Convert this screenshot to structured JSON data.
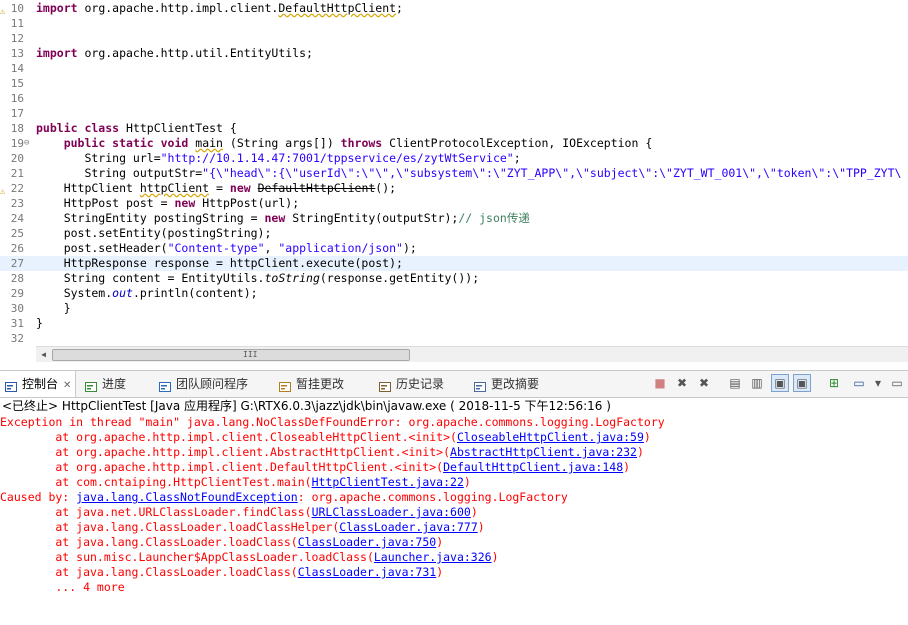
{
  "editor": {
    "lines": [
      {
        "num": "10",
        "segs": [
          {
            "t": "import ",
            "c": "kw"
          },
          {
            "t": "org.apache.http.impl.client.",
            "c": ""
          },
          {
            "t": "DefaultHttpClient",
            "c": "strike squig"
          },
          {
            "t": ";",
            "c": ""
          }
        ],
        "warn": true
      },
      {
        "num": "11",
        "segs": []
      },
      {
        "num": "12",
        "segs": []
      },
      {
        "num": "13",
        "segs": [
          {
            "t": "import ",
            "c": "kw"
          },
          {
            "t": "org.apache.http.util.EntityUtils;",
            "c": ""
          }
        ]
      },
      {
        "num": "14",
        "segs": []
      },
      {
        "num": "15",
        "segs": []
      },
      {
        "num": "16",
        "segs": []
      },
      {
        "num": "17",
        "segs": []
      },
      {
        "num": "18",
        "segs": [
          {
            "t": "public class ",
            "c": "kw"
          },
          {
            "t": "HttpClientTest {",
            "c": ""
          }
        ]
      },
      {
        "num": "19",
        "segs": [
          {
            "t": "    ",
            "c": ""
          },
          {
            "t": "public static void ",
            "c": "kw"
          },
          {
            "t": "main",
            "c": "squig"
          },
          {
            "t": " (String args[]) ",
            "c": ""
          },
          {
            "t": "throws ",
            "c": "kw"
          },
          {
            "t": "ClientProtocolException, IOException {",
            "c": ""
          }
        ],
        "fold": true
      },
      {
        "num": "20",
        "segs": [
          {
            "t": "       String url=",
            "c": ""
          },
          {
            "t": "\"http://10.1.14.47:7001/tppservice/es/zytWtService\"",
            "c": "str"
          },
          {
            "t": ";",
            "c": ""
          }
        ]
      },
      {
        "num": "21",
        "segs": [
          {
            "t": "       String outputStr=",
            "c": ""
          },
          {
            "t": "\"{\\\"head\\\":{\\\"userId\\\":\\\"\\\",\\\"subsystem\\\":\\\"ZYT_APP\\\",\\\"subject\\\":\\\"ZYT_WT_001\\\",\\\"token\\\":\\\"TPP_ZYT\\",
            "c": "str"
          }
        ]
      },
      {
        "num": "22",
        "segs": [
          {
            "t": "    HttpClient ",
            "c": ""
          },
          {
            "t": "httpClient",
            "c": "squig"
          },
          {
            "t": " = ",
            "c": ""
          },
          {
            "t": "new ",
            "c": "kw"
          },
          {
            "t": "DefaultHttpClient",
            "c": "strike"
          },
          {
            "t": "();",
            "c": ""
          }
        ],
        "warn": true
      },
      {
        "num": "23",
        "segs": [
          {
            "t": "    HttpPost post = ",
            "c": ""
          },
          {
            "t": "new ",
            "c": "kw"
          },
          {
            "t": "HttpPost(url);",
            "c": ""
          }
        ]
      },
      {
        "num": "24",
        "segs": [
          {
            "t": "    StringEntity postingString = ",
            "c": ""
          },
          {
            "t": "new ",
            "c": "kw"
          },
          {
            "t": "StringEntity(outputStr);",
            "c": ""
          },
          {
            "t": "// json传递",
            "c": "cmt"
          }
        ]
      },
      {
        "num": "25",
        "segs": [
          {
            "t": "    post.setEntity(postingString);",
            "c": ""
          }
        ]
      },
      {
        "num": "26",
        "segs": [
          {
            "t": "    post.setHeader(",
            "c": ""
          },
          {
            "t": "\"Content-type\"",
            "c": "str"
          },
          {
            "t": ", ",
            "c": ""
          },
          {
            "t": "\"application/json\"",
            "c": "str"
          },
          {
            "t": ");",
            "c": ""
          }
        ]
      },
      {
        "num": "27",
        "segs": [
          {
            "t": "    HttpResponse response = httpClient.execute(post);",
            "c": ""
          }
        ],
        "highlight": true
      },
      {
        "num": "28",
        "segs": [
          {
            "t": "    String content = EntityUtils.",
            "c": ""
          },
          {
            "t": "toString",
            "c": "ital"
          },
          {
            "t": "(response.getEntity());",
            "c": ""
          }
        ]
      },
      {
        "num": "29",
        "segs": [
          {
            "t": "    System.",
            "c": ""
          },
          {
            "t": "out",
            "c": "fld"
          },
          {
            "t": ".println(content);",
            "c": ""
          }
        ]
      },
      {
        "num": "30",
        "segs": [
          {
            "t": "    }",
            "c": ""
          }
        ]
      },
      {
        "num": "31",
        "segs": [
          {
            "t": "}",
            "c": ""
          }
        ]
      },
      {
        "num": "32",
        "segs": []
      }
    ]
  },
  "scrollbar": {
    "grip": "III"
  },
  "tabs": [
    {
      "label": "控制台",
      "name": "tab-console",
      "icon": "console-icon",
      "active": true,
      "close": "✕"
    },
    {
      "label": "进度",
      "name": "tab-progress",
      "icon": "progress-icon"
    },
    {
      "label": "团队顾问程序",
      "name": "tab-team-advisor",
      "icon": "team-advisor-icon"
    },
    {
      "label": "暂挂更改",
      "name": "tab-pending-changes",
      "icon": "pending-changes-icon"
    },
    {
      "label": "历史记录",
      "name": "tab-history",
      "icon": "history-icon"
    },
    {
      "label": "更改摘要",
      "name": "tab-change-summary",
      "icon": "change-summary-icon"
    }
  ],
  "toolbar": {
    "terminate": "■",
    "remove_launch": "✖",
    "remove_all": "✖",
    "clear": "▤",
    "scroll_lock": "▥",
    "pin1": "▣",
    "pin2": "▣",
    "open_console": "⊞",
    "display": "▭",
    "menu": "▾",
    "minimize": "▭"
  },
  "status": "<已终止> HttpClientTest [Java 应用程序] G:\\RTX6.0.3\\jazz\\jdk\\bin\\javaw.exe ( 2018-11-5 下午12:56:16 )",
  "console": [
    [
      {
        "t": "Exception in thread \"main\" java.lang.NoClassDefFoundError: org.apache.commons.logging.LogFactory"
      }
    ],
    [
      {
        "t": "        at org.apache.http.impl.client.CloseableHttpClient.<init>("
      },
      {
        "t": "CloseableHttpClient.java:59",
        "l": true
      },
      {
        "t": ")"
      }
    ],
    [
      {
        "t": "        at org.apache.http.impl.client.AbstractHttpClient.<init>("
      },
      {
        "t": "AbstractHttpClient.java:232",
        "l": true
      },
      {
        "t": ")"
      }
    ],
    [
      {
        "t": "        at org.apache.http.impl.client.DefaultHttpClient.<init>("
      },
      {
        "t": "DefaultHttpClient.java:148",
        "l": true
      },
      {
        "t": ")"
      }
    ],
    [
      {
        "t": "        at com.cntaiping.HttpClientTest.main("
      },
      {
        "t": "HttpClientTest.java:22",
        "l": true
      },
      {
        "t": ")"
      }
    ],
    [
      {
        "t": "Caused by: "
      },
      {
        "t": "java.lang.ClassNotFoundException",
        "l": true
      },
      {
        "t": ": org.apache.commons.logging.LogFactory"
      }
    ],
    [
      {
        "t": "        at java.net.URLClassLoader.findClass("
      },
      {
        "t": "URLClassLoader.java:600",
        "l": true
      },
      {
        "t": ")"
      }
    ],
    [
      {
        "t": "        at java.lang.ClassLoader.loadClassHelper("
      },
      {
        "t": "ClassLoader.java:777",
        "l": true
      },
      {
        "t": ")"
      }
    ],
    [
      {
        "t": "        at java.lang.ClassLoader.loadClass("
      },
      {
        "t": "ClassLoader.java:750",
        "l": true
      },
      {
        "t": ")"
      }
    ],
    [
      {
        "t": "        at sun.misc.Launcher$AppClassLoader.loadClass("
      },
      {
        "t": "Launcher.java:326",
        "l": true
      },
      {
        "t": ")"
      }
    ],
    [
      {
        "t": "        at java.lang.ClassLoader.loadClass("
      },
      {
        "t": "ClassLoader.java:731",
        "l": true
      },
      {
        "t": ")"
      }
    ],
    [
      {
        "t": "        ... 4 more"
      }
    ]
  ]
}
